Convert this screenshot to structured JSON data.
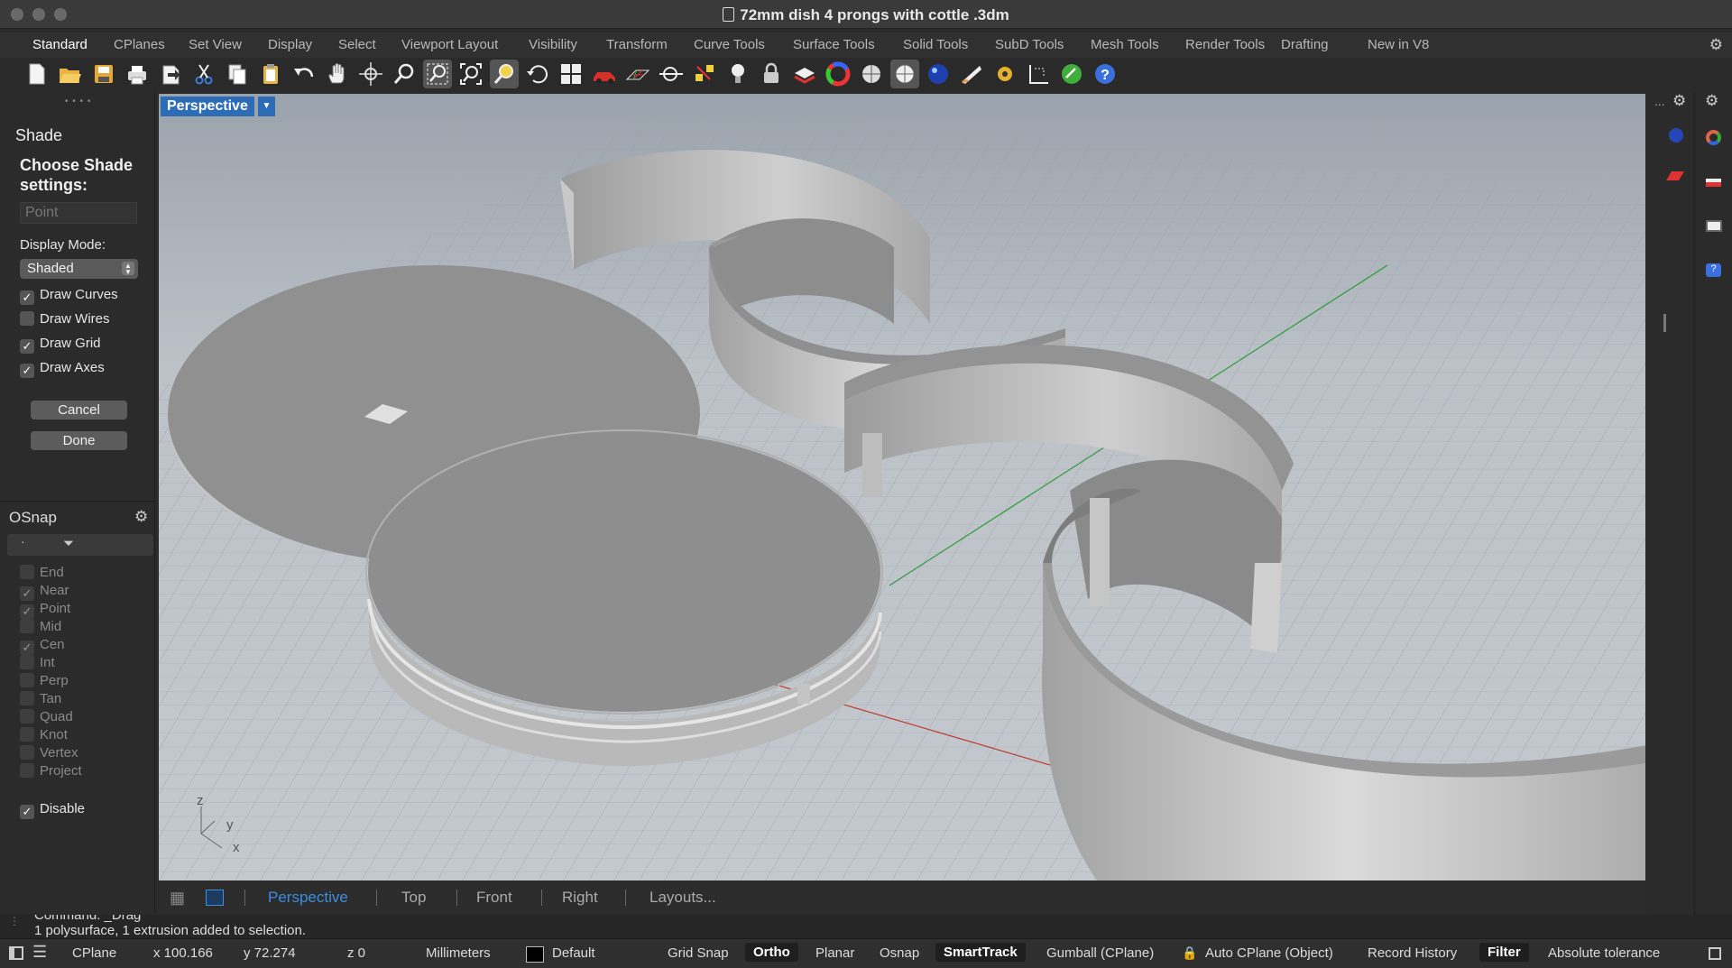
{
  "window": {
    "title": "72mm dish 4 prongs with cottle .3dm"
  },
  "tabs": [
    "Standard",
    "CPlanes",
    "Set View",
    "Display",
    "Select",
    "Viewport Layout",
    "Visibility",
    "Transform",
    "Curve Tools",
    "Surface Tools",
    "Solid Tools",
    "SubD Tools",
    "Mesh Tools",
    "Render Tools",
    "Drafting",
    "New in V8"
  ],
  "active_tab": "Standard",
  "toolbar_icons": [
    "new-icon",
    "open-icon",
    "save-icon",
    "print-icon",
    "import-icon",
    "cut-icon",
    "copy-icon",
    "paste-icon",
    "undo-icon",
    "pan-icon",
    "rotate-view-icon",
    "zoom-icon",
    "zoom-window-icon",
    "zoom-extents-icon",
    "zoom-selected-icon",
    "undo-view-icon",
    "four-views-icon",
    "car-icon",
    "grid-plane-icon",
    "cplane-icon",
    "snap-icon",
    "light-icon",
    "lock-icon",
    "layer-icon",
    "color-wheel-icon",
    "shade-icon",
    "rendered-icon",
    "sphere-icon",
    "material-icon",
    "settings-icon",
    "dimension-icon",
    "globe-icon",
    "help-icon"
  ],
  "shade_panel": {
    "title": "Shade",
    "heading": "Choose Shade settings:",
    "point_placeholder": "Point",
    "display_mode_label": "Display Mode:",
    "display_mode_value": "Shaded",
    "options": [
      {
        "label": "Draw Curves",
        "checked": true
      },
      {
        "label": "Draw Wires",
        "checked": false
      },
      {
        "label": "Draw Grid",
        "checked": true
      },
      {
        "label": "Draw Axes",
        "checked": true
      }
    ],
    "cancel_label": "Cancel",
    "done_label": "Done"
  },
  "osnap": {
    "title": "OSnap",
    "items": [
      {
        "label": "End",
        "checked": false
      },
      {
        "label": "Near",
        "checked": true
      },
      {
        "label": "Point",
        "checked": true
      },
      {
        "label": "Mid",
        "checked": false
      },
      {
        "label": "Cen",
        "checked": true
      },
      {
        "label": "Int",
        "checked": false
      },
      {
        "label": "Perp",
        "checked": false
      },
      {
        "label": "Tan",
        "checked": false
      },
      {
        "label": "Quad",
        "checked": false
      },
      {
        "label": "Knot",
        "checked": false
      },
      {
        "label": "Vertex",
        "checked": false
      },
      {
        "label": "Project",
        "checked": false
      }
    ],
    "disable_label": "Disable",
    "disable_checked": true
  },
  "viewport": {
    "label": "Perspective",
    "axis_labels": {
      "z": "z",
      "y": "y",
      "x": "x"
    }
  },
  "view_tabs": [
    "Perspective",
    "Top",
    "Front",
    "Right",
    "Layouts..."
  ],
  "active_view_tab": "Perspective",
  "command_line": {
    "line1": "Command: _Drag",
    "line2": "1 polysurface, 1 extrusion added to selection."
  },
  "status": {
    "cplane": "CPlane",
    "x": "x 100.166",
    "y": "y 72.274",
    "z": "z 0",
    "units": "Millimeters",
    "layer": "Default",
    "grid_snap": "Grid Snap",
    "ortho": "Ortho",
    "planar": "Planar",
    "osnap": "Osnap",
    "smarttrack": "SmartTrack",
    "gumball": "Gumball (CPlane)",
    "auto_cplane": "Auto CPlane (Object)",
    "record_history": "Record History",
    "filter": "Filter",
    "tolerance": "Absolute tolerance"
  },
  "colors": {
    "accent": "#2d6db8",
    "active_view_tab": "#3b8de0",
    "x_axis": "#c0392b",
    "y_axis": "#2e9b3a"
  }
}
